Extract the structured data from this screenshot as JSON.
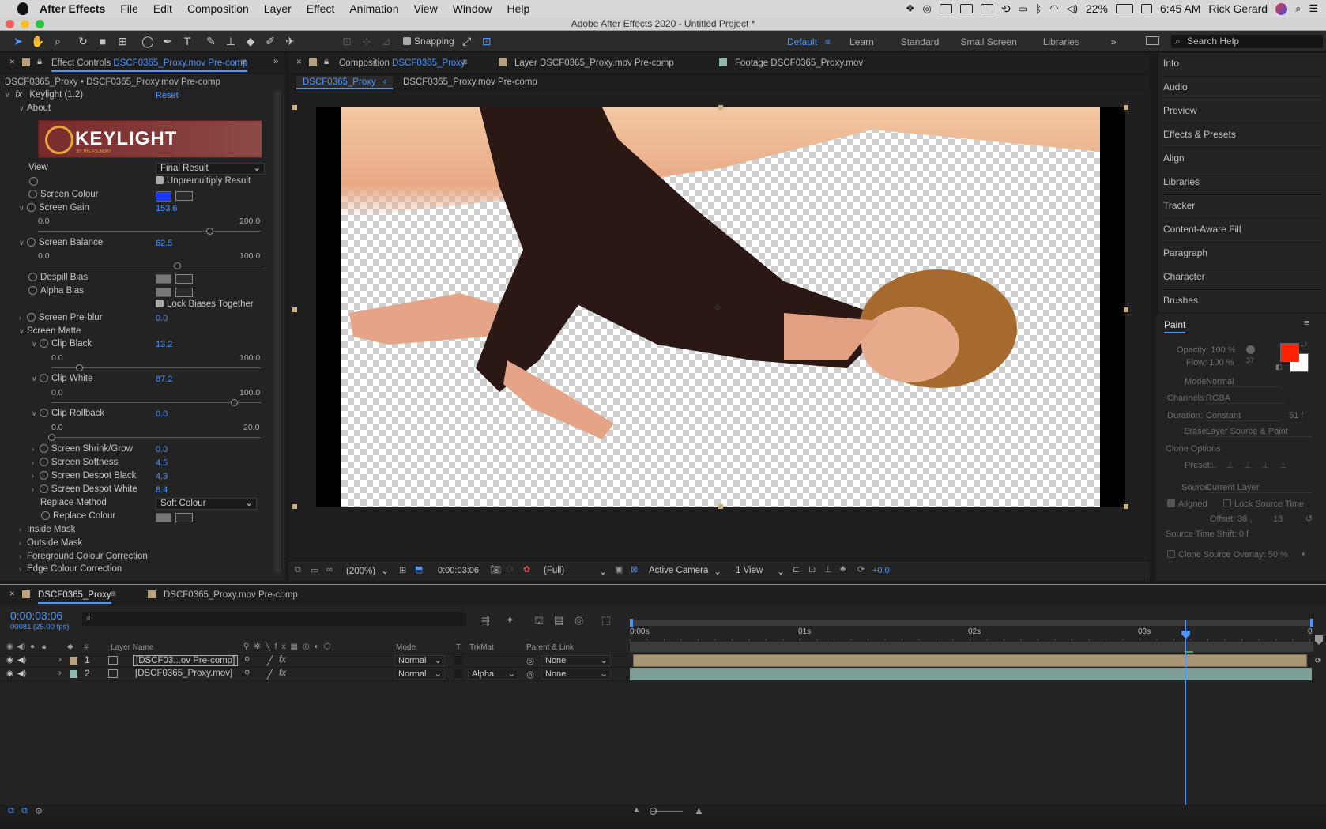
{
  "menubar": {
    "app": "After Effects",
    "items": [
      "File",
      "Edit",
      "Composition",
      "Layer",
      "Effect",
      "Animation",
      "View",
      "Window",
      "Help"
    ],
    "battery": "22%",
    "time": "6:45 AM",
    "user": "Rick Gerard"
  },
  "window": {
    "title": "Adobe After Effects 2020 - Untitled Project *"
  },
  "toolbar": {
    "snapping": "Snapping",
    "workspaces": [
      "Default",
      "Learn",
      "Standard",
      "Small Screen",
      "Libraries"
    ],
    "search_placeholder": "Search Help"
  },
  "effect_controls": {
    "tab_prefix": "Effect Controls",
    "tab_layer": "DSCF0365_Proxy.mov Pre-comp",
    "breadcrumb": "DSCF0365_Proxy • DSCF0365_Proxy.mov Pre-comp",
    "effect_name": "Keylight (1.2)",
    "reset": "Reset",
    "about": "About",
    "logo_text": "KEYLIGHT",
    "logo_sub": "BY THE FOUNDRY",
    "view_label": "View",
    "view_value": "Final Result",
    "unpremultiply": "Unpremultiply Result",
    "screen_colour": "Screen Colour",
    "screen_colour_hex": "#1736ff",
    "screen_gain": {
      "label": "Screen Gain",
      "value": "153.6",
      "min": "0.0",
      "max": "200.0",
      "fraction": 0.768
    },
    "screen_balance": {
      "label": "Screen Balance",
      "value": "62.5",
      "min": "0.0",
      "max": "100.0",
      "fraction": 0.625
    },
    "despill_bias": "Despill Bias",
    "alpha_bias": "Alpha Bias",
    "lock_biases": "Lock Biases Together",
    "screen_preblur": {
      "label": "Screen Pre-blur",
      "value": "0.0"
    },
    "screen_matte": "Screen Matte",
    "clip_black": {
      "label": "Clip Black",
      "value": "13.2",
      "min": "0.0",
      "max": "100.0",
      "fraction": 0.132
    },
    "clip_white": {
      "label": "Clip White",
      "value": "87.2",
      "min": "0.0",
      "max": "100.0",
      "fraction": 0.872
    },
    "clip_rollback": {
      "label": "Clip Rollback",
      "value": "0.0",
      "min": "0.0",
      "max": "20.0",
      "fraction": 0.0
    },
    "screen_shrink": {
      "label": "Screen Shrink/Grow",
      "value": "0.0"
    },
    "screen_softness": {
      "label": "Screen Softness",
      "value": "4.5"
    },
    "despot_black": {
      "label": "Screen Despot Black",
      "value": "4.3"
    },
    "despot_white": {
      "label": "Screen Despot White",
      "value": "8.4"
    },
    "replace_method": {
      "label": "Replace Method",
      "value": "Soft Colour"
    },
    "replace_colour": "Replace Colour",
    "inside_mask": "Inside Mask",
    "outside_mask": "Outside Mask",
    "fg_correction": "Foreground Colour Correction",
    "edge_correction": "Edge Colour Correction"
  },
  "composition": {
    "tab_prefix": "Composition",
    "tab_name": "DSCF0365_Proxy",
    "layer_tab": "Layer DSCF0365_Proxy.mov Pre-comp",
    "footage_tab": "Footage DSCF0365_Proxy.mov",
    "crumb_active": "DSCF0365_Proxy",
    "crumb_next": "DSCF0365_Proxy.mov Pre-comp",
    "zoom": "(200%)",
    "timecode": "0:00:03:06",
    "resolution": "(Full)",
    "camera": "Active Camera",
    "views": "1 View",
    "exposure": "+0.0"
  },
  "right_panels": [
    "Info",
    "Audio",
    "Preview",
    "Effects & Presets",
    "Align",
    "Libraries",
    "Tracker",
    "Content-Aware Fill",
    "Paragraph",
    "Character",
    "Brushes"
  ],
  "paint": {
    "title": "Paint",
    "opacity": "Opacity: 100 %",
    "flow": "Flow: 100 %",
    "brush_size": "37",
    "mode_label": "Mode:",
    "mode": "Normal",
    "channels_label": "Channels:",
    "channels": "RGBA",
    "duration_label": "Duration:",
    "duration": "Constant",
    "duration_val": "51  f",
    "erase_label": "Erase:",
    "erase": "Layer Source & Paint",
    "clone_options": "Clone Options",
    "preset_label": "Preset:",
    "source_label": "Source:",
    "source": "Current Layer",
    "aligned": "Aligned",
    "lock_source_time": "Lock Source Time",
    "offset": "Offset: 38 ,",
    "offset_y": "13",
    "source_time_shift": "Source Time Shift: 0  f",
    "clone_overlay": "Clone Source Overlay:  50 %",
    "fg_color": "#ff2200",
    "bg_color": "#ffffff"
  },
  "timeline": {
    "tab": "DSCF0365_Proxy",
    "tab2": "DSCF0365_Proxy.mov Pre-comp",
    "timecode": "0:00:03:06",
    "frame_info": "00081 (25.00 fps)",
    "headers": {
      "num": "#",
      "layer_name": "Layer Name",
      "mode": "Mode",
      "t": "T",
      "trkmat": "TrkMat",
      "parent": "Parent & Link"
    },
    "layers": [
      {
        "num": "1",
        "name": "[DSCF03...ov Pre-comp]",
        "mode": "Normal",
        "trkmat": "",
        "parent": "None",
        "color": "#b6a27e"
      },
      {
        "num": "2",
        "name": "[DSCF0365_Proxy.mov]",
        "mode": "Normal",
        "trkmat": "Alpha",
        "parent": "None",
        "color": "#8fb7ad"
      }
    ],
    "ruler": [
      "0:00s",
      "01s",
      "02s",
      "03s",
      "0"
    ],
    "playhead_fraction": 0.813
  }
}
